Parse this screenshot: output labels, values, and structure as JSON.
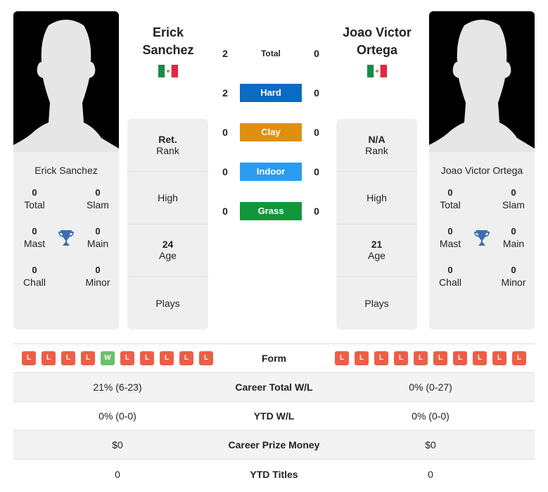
{
  "colors": {
    "hard": "#0a6bc2",
    "clay": "#e0900f",
    "indoor": "#2b9bf0",
    "grass": "#13963a",
    "loss": "#ec5f46",
    "win": "#6bbf6b",
    "trophy": "#3b6db5"
  },
  "player1": {
    "name_line1": "Erick",
    "name_line2": "Sanchez",
    "full_name": "Erick Sanchez",
    "flag": "mexico-flag",
    "titles": {
      "total": "0",
      "total_label": "Total",
      "slam": "0",
      "slam_label": "Slam",
      "mast": "0",
      "mast_label": "Mast",
      "main": "0",
      "main_label": "Main",
      "chall": "0",
      "chall_label": "Chall",
      "minor": "0",
      "minor_label": "Minor"
    },
    "rank_value": "Ret.",
    "rank_label": "Rank",
    "high_label": "High",
    "age_value": "24",
    "age_label": "Age",
    "plays_label": "Plays",
    "form": [
      "L",
      "L",
      "L",
      "L",
      "W",
      "L",
      "L",
      "L",
      "L",
      "L"
    ],
    "career_wl": "21% (6-23)",
    "ytd_wl": "0% (0-0)",
    "prize": "$0",
    "ytd_titles": "0"
  },
  "player2": {
    "name_line1": "Joao Victor",
    "name_line2": "Ortega",
    "full_name": "Joao Victor Ortega",
    "flag": "mexico-flag",
    "titles": {
      "total": "0",
      "total_label": "Total",
      "slam": "0",
      "slam_label": "Slam",
      "mast": "0",
      "mast_label": "Mast",
      "main": "0",
      "main_label": "Main",
      "chall": "0",
      "chall_label": "Chall",
      "minor": "0",
      "minor_label": "Minor"
    },
    "rank_value": "N/A",
    "rank_label": "Rank",
    "high_label": "High",
    "age_value": "21",
    "age_label": "Age",
    "plays_label": "Plays",
    "form": [
      "L",
      "L",
      "L",
      "L",
      "L",
      "L",
      "L",
      "L",
      "L",
      "L"
    ],
    "career_wl": "0% (0-27)",
    "ytd_wl": "0% (0-0)",
    "prize": "$0",
    "ytd_titles": "0"
  },
  "h2h": [
    {
      "label": "Total",
      "p1": "2",
      "p2": "0"
    },
    {
      "label": "Hard",
      "p1": "2",
      "p2": "0"
    },
    {
      "label": "Clay",
      "p1": "0",
      "p2": "0"
    },
    {
      "label": "Indoor",
      "p1": "0",
      "p2": "0"
    },
    {
      "label": "Grass",
      "p1": "0",
      "p2": "0"
    }
  ],
  "stats_labels": {
    "form": "Form",
    "career_wl": "Career Total W/L",
    "ytd_wl": "YTD W/L",
    "prize": "Career Prize Money",
    "ytd_titles": "YTD Titles"
  }
}
